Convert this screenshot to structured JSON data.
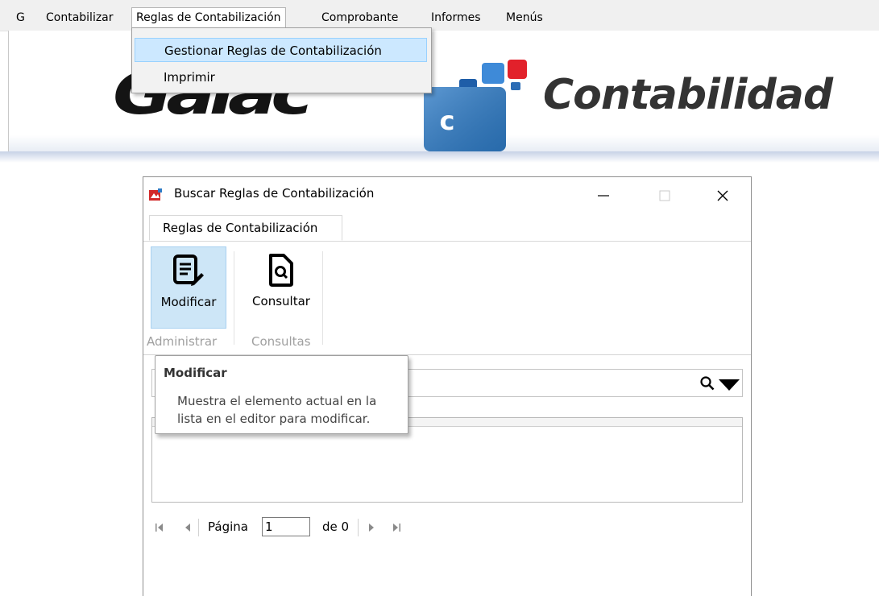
{
  "menubar": {
    "items": [
      {
        "label": "G"
      },
      {
        "label": "Contabilizar"
      },
      {
        "label": "Reglas de Contabilización"
      },
      {
        "label": "Comprobante"
      },
      {
        "label": "Informes"
      },
      {
        "label": "Menús"
      }
    ]
  },
  "dropdown": {
    "items": [
      {
        "label": "Gestionar Reglas de Contabilización"
      },
      {
        "label": "Imprimir"
      }
    ]
  },
  "banner": {
    "brand": "Galac",
    "product": "Contabilidad",
    "product_letter": "c"
  },
  "window": {
    "title": "Buscar Reglas de Contabilización",
    "tab": "Reglas de Contabilización",
    "ribbon": {
      "buttons": [
        {
          "label": "Modificar"
        },
        {
          "label": "Consultar"
        }
      ],
      "groups": [
        {
          "label": "Administrar"
        },
        {
          "label": "Consultas"
        }
      ]
    },
    "search": {
      "value": ""
    },
    "pager": {
      "page_label": "Página",
      "page_value": "1",
      "of_label": "de 0"
    }
  },
  "tooltip": {
    "title": "Modificar",
    "body": "Muestra el elemento actual en la lista en el editor para modificar."
  },
  "colors": {
    "menu_highlight": "#cce8ff",
    "ribbon_active": "#cde6f7",
    "logo_blue": "#2e7bc6",
    "logo_red": "#e2212b"
  }
}
